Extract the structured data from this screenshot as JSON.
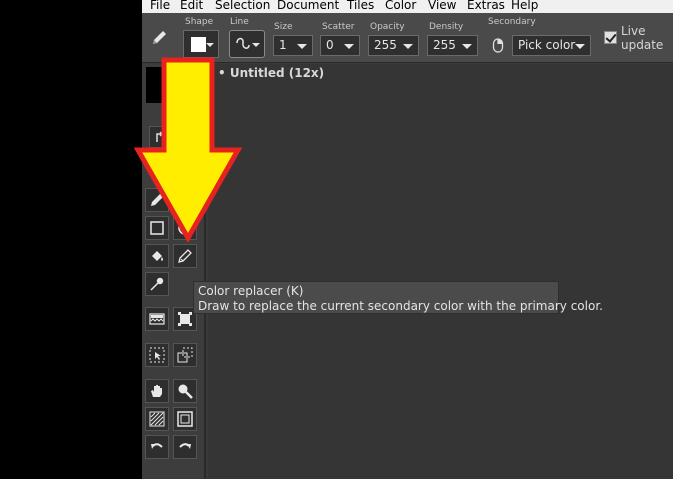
{
  "menu": [
    "File",
    "Edit",
    "Selection",
    "Document",
    "Tiles",
    "Color",
    "View",
    "Extras",
    "Help"
  ],
  "toolbar": {
    "shape_label": "Shape",
    "line_label": "Line",
    "size_label": "Size",
    "size_value": "1",
    "scatter_label": "Scatter",
    "scatter_value": "0",
    "opacity_label": "Opacity",
    "opacity_value": "255",
    "density_label": "Density",
    "density_value": "255",
    "secondary_label": "Secondary",
    "secondary_value": "Pick color",
    "live_update_line1": "Live",
    "live_update_line2": "update",
    "live_update_checked": true
  },
  "document": {
    "title": "• Untitled   (12x)"
  },
  "tooltip": {
    "title": "Color replacer (K)",
    "description": "Draw to replace the current secondary color with the primary color."
  },
  "tools": [
    "pencil-icon",
    "rectangle-icon",
    "ellipse-icon",
    "fill-icon",
    "color-replacer-icon",
    "eyedropper-icon",
    "gradient-icon",
    "transform-icon",
    "select-icon",
    "move-selection-icon",
    "hand-icon",
    "zoom-icon",
    "pattern-icon",
    "frame-icon",
    "undo-icon",
    "redo-icon"
  ],
  "colors": {
    "arrow_fill": "#ffee00",
    "arrow_stroke": "#e8221e",
    "canvas_bg": "#353535",
    "toolbar_bg": "#4a4a4a"
  }
}
